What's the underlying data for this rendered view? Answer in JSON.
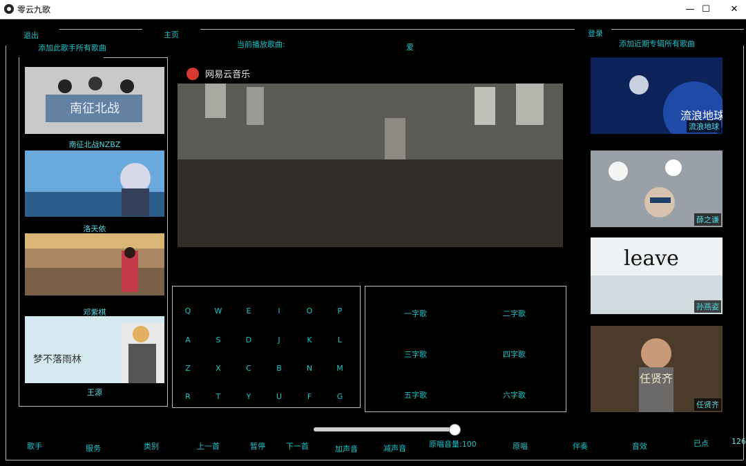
{
  "window": {
    "title": "零云九歌",
    "min": "—",
    "max": "☐",
    "close": "✕"
  },
  "top": {
    "exit": "退出",
    "home": "主页",
    "now_playing_label": "当前播放歌曲:",
    "now_playing_value": "爱",
    "login": "登录",
    "add_artist_all": "添加此歌手所有歌曲",
    "add_album_all": "添加近期专辑所有歌曲"
  },
  "video": {
    "logo_text": "网易云音乐"
  },
  "artists": [
    {
      "name": "南征北战NZBZ",
      "color": "#6b7c92",
      "art_text": "南征北战"
    },
    {
      "name": "洛天依",
      "color": "#4a90c8",
      "art_text": ""
    },
    {
      "name": "邓紫棋",
      "color": "#b59268",
      "art_text": ""
    },
    {
      "name": "王源",
      "color": "#cfe6ef",
      "art_text": "梦不落雨林"
    }
  ],
  "albums": [
    {
      "name": "流浪地球",
      "color": "#0f2a66",
      "art_text": "流浪地球"
    },
    {
      "name": "薛之谦",
      "color": "#8a8f96",
      "art_text": ""
    },
    {
      "name": "孙燕姿",
      "color": "#e8edf0",
      "art_text": "leave"
    },
    {
      "name": "任贤齐",
      "color": "#5c4431",
      "art_text": "任贤齐"
    }
  ],
  "keyboard": [
    [
      "Q",
      "W",
      "E",
      "I",
      "O",
      "P"
    ],
    [
      "A",
      "S",
      "D",
      "J",
      "K",
      "L"
    ],
    [
      "Z",
      "X",
      "C",
      "B",
      "N",
      "M"
    ],
    [
      "R",
      "T",
      "Y",
      "U",
      "F",
      "G"
    ]
  ],
  "length_groups": [
    "一字歌",
    "二字歌",
    "三字歌",
    "四字歌",
    "五字歌",
    "六字歌"
  ],
  "volume": {
    "level": 1.0
  },
  "bottom": {
    "singer": "歌手",
    "service": "服务",
    "category": "类别",
    "prev": "上一首",
    "pause": "暂停",
    "next": "下一首",
    "vol_up": "加声音",
    "vol_down": "减声音",
    "orig_volume": "原唱音量:100",
    "original": "原唱",
    "accompany": "伴奏",
    "effect": "音效",
    "selected": "已点",
    "count": "126"
  }
}
